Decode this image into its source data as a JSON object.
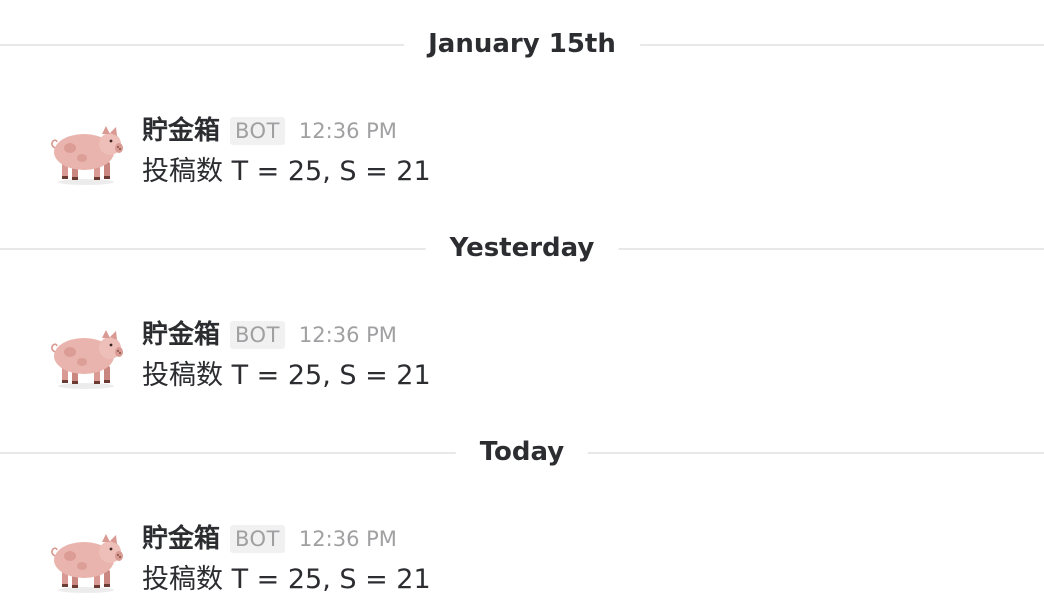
{
  "colors": {
    "divider_line": "#e8e8e8",
    "text_primary": "#2c2d30",
    "text_muted": "#a0a0a2",
    "badge_bg": "#f1f1f1",
    "pig_pink": "#e9b4ad"
  },
  "sections": [
    {
      "date_label": "January 15th",
      "message": {
        "avatar_icon": "pig-icon",
        "sender": "貯金箱",
        "badge": "BOT",
        "time": "12:36 PM",
        "text": "投稿数 T = 25, S = 21"
      }
    },
    {
      "date_label": "Yesterday",
      "message": {
        "avatar_icon": "pig-icon",
        "sender": "貯金箱",
        "badge": "BOT",
        "time": "12:36 PM",
        "text": "投稿数 T = 25, S = 21"
      }
    },
    {
      "date_label": "Today",
      "message": {
        "avatar_icon": "pig-icon",
        "sender": "貯金箱",
        "badge": "BOT",
        "time": "12:36 PM",
        "text": "投稿数 T = 25, S = 21"
      }
    }
  ]
}
